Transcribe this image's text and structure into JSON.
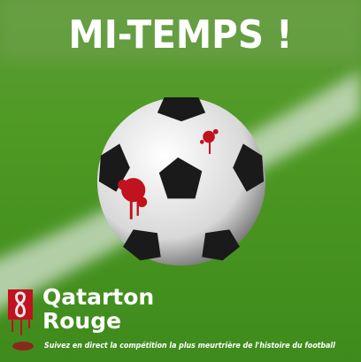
{
  "title": "MI-TEMPS !",
  "brand": {
    "line1": "Qatarton",
    "line2": "Rouge",
    "logo": "bloody-trophy-logo"
  },
  "tagline": "Suivez en direct la compétition la plus meurtrière de l'histoire du football",
  "colors": {
    "grass": "#3f8a1e",
    "blood": "#c1121f",
    "text": "#ffffff"
  }
}
